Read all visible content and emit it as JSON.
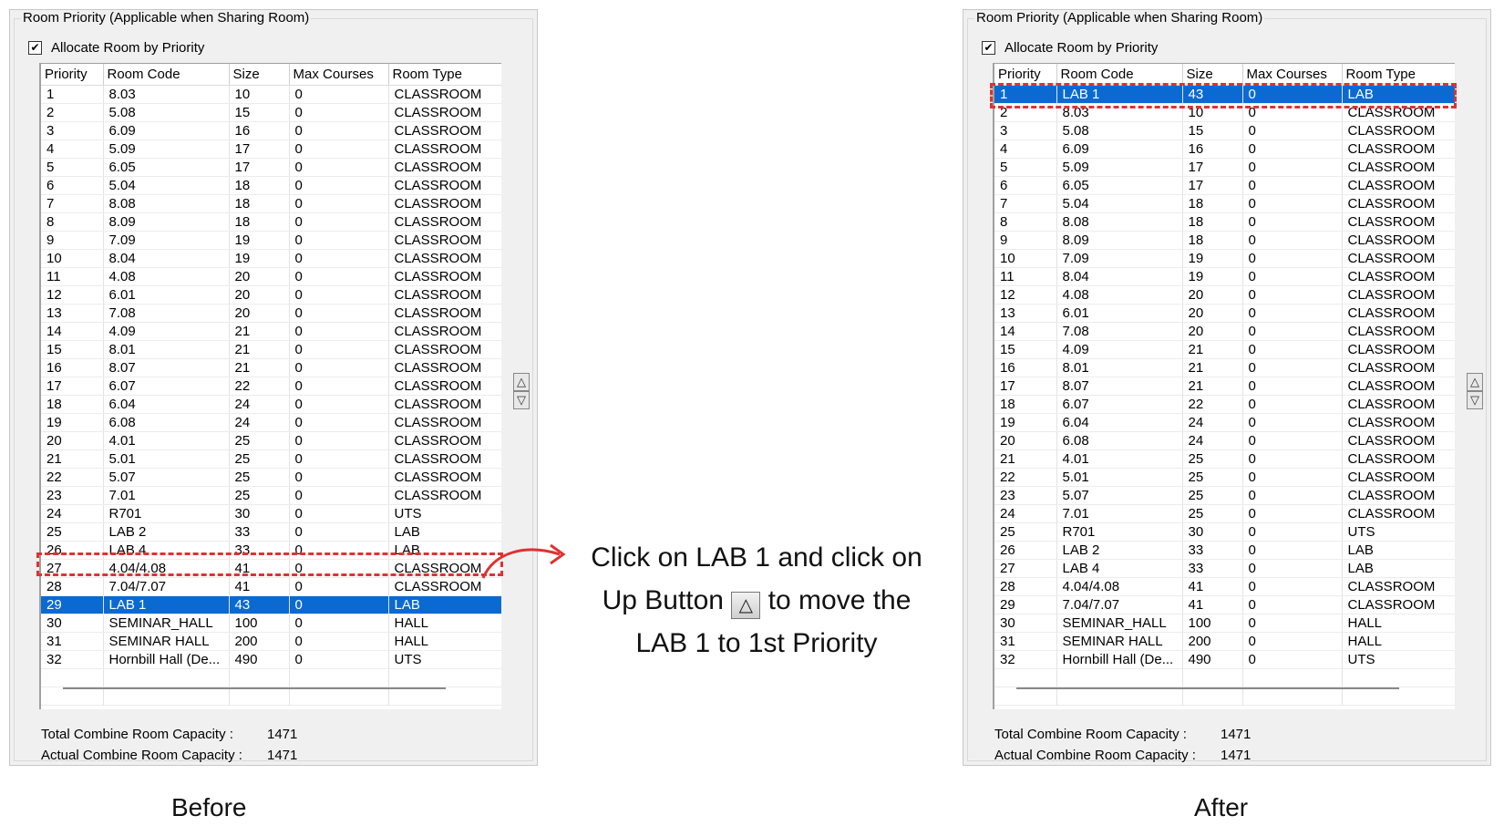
{
  "panels": {
    "before": {
      "group_title": "Room Priority (Applicable when Sharing Room)",
      "allocate_label": "Allocate Room by Priority",
      "allocate_checked": "✔",
      "columns": [
        "Priority",
        "Room Code",
        "Size",
        "Max Courses",
        "Room Type"
      ],
      "rows": [
        [
          "1",
          "8.03",
          "10",
          "0",
          "CLASSROOM"
        ],
        [
          "2",
          "5.08",
          "15",
          "0",
          "CLASSROOM"
        ],
        [
          "3",
          "6.09",
          "16",
          "0",
          "CLASSROOM"
        ],
        [
          "4",
          "5.09",
          "17",
          "0",
          "CLASSROOM"
        ],
        [
          "5",
          "6.05",
          "17",
          "0",
          "CLASSROOM"
        ],
        [
          "6",
          "5.04",
          "18",
          "0",
          "CLASSROOM"
        ],
        [
          "7",
          "8.08",
          "18",
          "0",
          "CLASSROOM"
        ],
        [
          "8",
          "8.09",
          "18",
          "0",
          "CLASSROOM"
        ],
        [
          "9",
          "7.09",
          "19",
          "0",
          "CLASSROOM"
        ],
        [
          "10",
          "8.04",
          "19",
          "0",
          "CLASSROOM"
        ],
        [
          "11",
          "4.08",
          "20",
          "0",
          "CLASSROOM"
        ],
        [
          "12",
          "6.01",
          "20",
          "0",
          "CLASSROOM"
        ],
        [
          "13",
          "7.08",
          "20",
          "0",
          "CLASSROOM"
        ],
        [
          "14",
          "4.09",
          "21",
          "0",
          "CLASSROOM"
        ],
        [
          "15",
          "8.01",
          "21",
          "0",
          "CLASSROOM"
        ],
        [
          "16",
          "8.07",
          "21",
          "0",
          "CLASSROOM"
        ],
        [
          "17",
          "6.07",
          "22",
          "0",
          "CLASSROOM"
        ],
        [
          "18",
          "6.04",
          "24",
          "0",
          "CLASSROOM"
        ],
        [
          "19",
          "6.08",
          "24",
          "0",
          "CLASSROOM"
        ],
        [
          "20",
          "4.01",
          "25",
          "0",
          "CLASSROOM"
        ],
        [
          "21",
          "5.01",
          "25",
          "0",
          "CLASSROOM"
        ],
        [
          "22",
          "5.07",
          "25",
          "0",
          "CLASSROOM"
        ],
        [
          "23",
          "7.01",
          "25",
          "0",
          "CLASSROOM"
        ],
        [
          "24",
          "R701",
          "30",
          "0",
          "UTS"
        ],
        [
          "25",
          "LAB 2",
          "33",
          "0",
          "LAB"
        ],
        [
          "26",
          "LAB 4",
          "33",
          "0",
          "LAB"
        ],
        [
          "27",
          "4.04/4.08",
          "41",
          "0",
          "CLASSROOM"
        ],
        [
          "28",
          "7.04/7.07",
          "41",
          "0",
          "CLASSROOM"
        ],
        [
          "29",
          "LAB 1",
          "43",
          "0",
          "LAB"
        ],
        [
          "30",
          "SEMINAR_HALL",
          "100",
          "0",
          "HALL"
        ],
        [
          "31",
          "SEMINAR HALL",
          "200",
          "0",
          "HALL"
        ],
        [
          "32",
          "Hornbill Hall (De...",
          "490",
          "0",
          "UTS"
        ]
      ],
      "selected_row": 28,
      "total_label": "Total Combine Room Capacity :",
      "total_value": "1471",
      "actual_label": "Actual Combine Room Capacity :",
      "actual_value": "1471",
      "up_glyph": "△",
      "down_glyph": "▽"
    },
    "after": {
      "group_title": "Room Priority (Applicable when Sharing Room)",
      "allocate_label": "Allocate Room by Priority",
      "allocate_checked": "✔",
      "columns": [
        "Priority",
        "Room Code",
        "Size",
        "Max Courses",
        "Room Type"
      ],
      "rows": [
        [
          "1",
          "LAB 1",
          "43",
          "0",
          "LAB"
        ],
        [
          "2",
          "8.03",
          "10",
          "0",
          "CLASSROOM"
        ],
        [
          "3",
          "5.08",
          "15",
          "0",
          "CLASSROOM"
        ],
        [
          "4",
          "6.09",
          "16",
          "0",
          "CLASSROOM"
        ],
        [
          "5",
          "5.09",
          "17",
          "0",
          "CLASSROOM"
        ],
        [
          "6",
          "6.05",
          "17",
          "0",
          "CLASSROOM"
        ],
        [
          "7",
          "5.04",
          "18",
          "0",
          "CLASSROOM"
        ],
        [
          "8",
          "8.08",
          "18",
          "0",
          "CLASSROOM"
        ],
        [
          "9",
          "8.09",
          "18",
          "0",
          "CLASSROOM"
        ],
        [
          "10",
          "7.09",
          "19",
          "0",
          "CLASSROOM"
        ],
        [
          "11",
          "8.04",
          "19",
          "0",
          "CLASSROOM"
        ],
        [
          "12",
          "4.08",
          "20",
          "0",
          "CLASSROOM"
        ],
        [
          "13",
          "6.01",
          "20",
          "0",
          "CLASSROOM"
        ],
        [
          "14",
          "7.08",
          "20",
          "0",
          "CLASSROOM"
        ],
        [
          "15",
          "4.09",
          "21",
          "0",
          "CLASSROOM"
        ],
        [
          "16",
          "8.01",
          "21",
          "0",
          "CLASSROOM"
        ],
        [
          "17",
          "8.07",
          "21",
          "0",
          "CLASSROOM"
        ],
        [
          "18",
          "6.07",
          "22",
          "0",
          "CLASSROOM"
        ],
        [
          "19",
          "6.04",
          "24",
          "0",
          "CLASSROOM"
        ],
        [
          "20",
          "6.08",
          "24",
          "0",
          "CLASSROOM"
        ],
        [
          "21",
          "4.01",
          "25",
          "0",
          "CLASSROOM"
        ],
        [
          "22",
          "5.01",
          "25",
          "0",
          "CLASSROOM"
        ],
        [
          "23",
          "5.07",
          "25",
          "0",
          "CLASSROOM"
        ],
        [
          "24",
          "7.01",
          "25",
          "0",
          "CLASSROOM"
        ],
        [
          "25",
          "R701",
          "30",
          "0",
          "UTS"
        ],
        [
          "26",
          "LAB 2",
          "33",
          "0",
          "LAB"
        ],
        [
          "27",
          "LAB 4",
          "33",
          "0",
          "LAB"
        ],
        [
          "28",
          "4.04/4.08",
          "41",
          "0",
          "CLASSROOM"
        ],
        [
          "29",
          "7.04/7.07",
          "41",
          "0",
          "CLASSROOM"
        ],
        [
          "30",
          "SEMINAR_HALL",
          "100",
          "0",
          "HALL"
        ],
        [
          "31",
          "SEMINAR HALL",
          "200",
          "0",
          "HALL"
        ],
        [
          "32",
          "Hornbill Hall (De...",
          "490",
          "0",
          "UTS"
        ]
      ],
      "selected_row": 0,
      "total_label": "Total Combine Room Capacity :",
      "total_value": "1471",
      "actual_label": "Actual Combine Room Capacity :",
      "actual_value": "1471",
      "up_glyph": "△",
      "down_glyph": "▽"
    }
  },
  "instruction": {
    "line1": "Click on LAB 1 and click on",
    "line2_pre": "Up Button",
    "line2_icon": "△",
    "line2_post": "to move the",
    "line3": "LAB 1 to 1st Priority"
  },
  "captions": {
    "before": "Before",
    "after": "After"
  },
  "colors": {
    "selection": "#0a6ad2",
    "highlight": "#e03131"
  }
}
